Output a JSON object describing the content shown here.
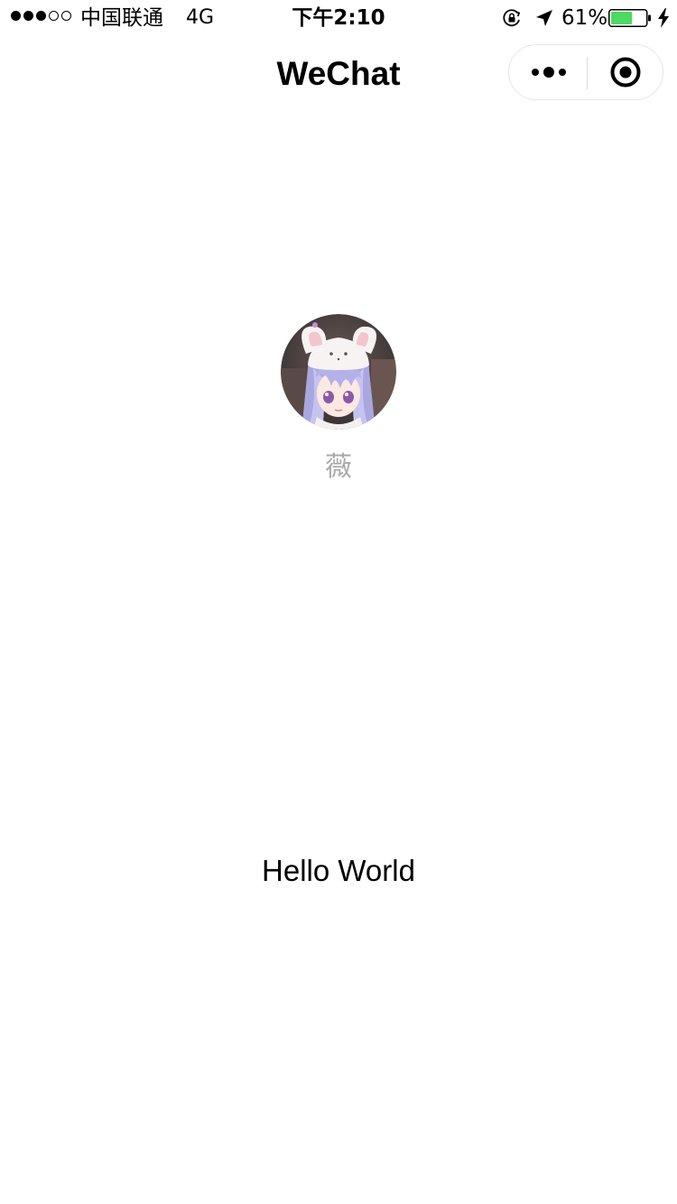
{
  "status_bar": {
    "carrier": "中国联通",
    "network": "4G",
    "time": "下午2:10",
    "battery_percent_text": "61%",
    "battery_level": 0.61,
    "signal_strength": 3,
    "signal_max": 5,
    "icons": [
      "signal-dots-icon",
      "orientation-lock-icon",
      "location-arrow-icon",
      "battery-icon",
      "charging-bolt-icon"
    ]
  },
  "nav": {
    "title": "WeChat",
    "icons": [
      "more-dots-icon",
      "target-circle-icon"
    ]
  },
  "profile": {
    "nickname": "薇",
    "avatar_icon": "anime-bunny-avatar"
  },
  "motto": "Hello World",
  "colors": {
    "background": "#ffffff",
    "text": "#000000",
    "nickname": "#aaaaaa",
    "battery_fill": "#4cd964",
    "capsule_border": "#e6e6e6"
  }
}
